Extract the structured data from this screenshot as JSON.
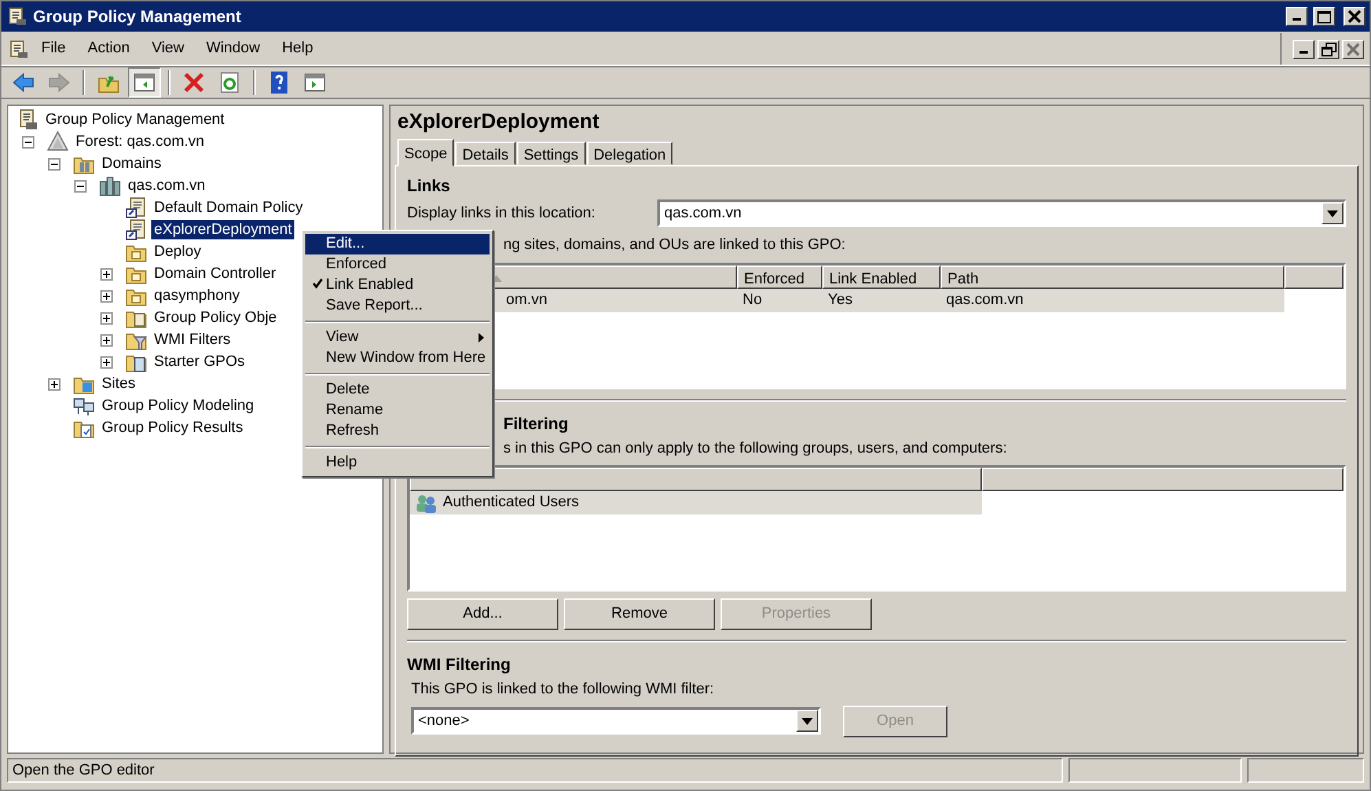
{
  "window": {
    "title": "Group Policy Management",
    "controls": [
      {
        "kind": "minimize",
        "disabled": false
      },
      {
        "kind": "maximize",
        "disabled": false
      },
      {
        "kind": "close",
        "disabled": false
      }
    ]
  },
  "menu_bar": [
    "File",
    "Action",
    "View",
    "Window",
    "Help"
  ],
  "inner_controls": [
    {
      "kind": "minimize",
      "disabled": false
    },
    {
      "kind": "restore",
      "disabled": false
    },
    {
      "kind": "close",
      "disabled": true
    }
  ],
  "toolbar": [
    {
      "kind": "back",
      "disabled": false,
      "pressed": false
    },
    {
      "kind": "forward",
      "disabled": true,
      "pressed": false
    },
    {
      "kind": "separator"
    },
    {
      "kind": "up",
      "disabled": false,
      "pressed": false
    },
    {
      "kind": "tree",
      "disabled": false,
      "pressed": true
    },
    {
      "kind": "separator"
    },
    {
      "kind": "delete",
      "disabled": false,
      "pressed": false
    },
    {
      "kind": "refresh",
      "disabled": false,
      "pressed": false
    },
    {
      "kind": "separator"
    },
    {
      "kind": "help",
      "disabled": false,
      "pressed": false
    },
    {
      "kind": "pane",
      "disabled": false,
      "pressed": false
    }
  ],
  "tree": [
    {
      "label": "Group Policy Management",
      "selected": false,
      "children": [
        {
          "label": "Forest: qas.com.vn",
          "expanded": true,
          "selected": false,
          "children": [
            {
              "label": "Domains",
              "expanded": true,
              "selected": false,
              "children": [
                {
                  "label": "qas.com.vn",
                  "expanded": true,
                  "selected": false,
                  "children": [
                    {
                      "label": "Default Domain Policy",
                      "selected": false
                    },
                    {
                      "label": "eXplorerDeployment",
                      "selected": true
                    },
                    {
                      "label": "Deploy",
                      "selected": false
                    },
                    {
                      "label": "Domain Controller",
                      "expanded": false,
                      "selected": false
                    },
                    {
                      "label": "qasymphony",
                      "expanded": false,
                      "selected": false
                    },
                    {
                      "label": "Group Policy Obje",
                      "expanded": false,
                      "selected": false
                    },
                    {
                      "label": "WMI Filters",
                      "expanded": false,
                      "selected": false
                    },
                    {
                      "label": "Starter GPOs",
                      "expanded": false,
                      "selected": false
                    }
                  ]
                }
              ]
            },
            {
              "label": "Sites",
              "expanded": false,
              "selected": false
            },
            {
              "label": "Group Policy Modeling",
              "selected": false
            },
            {
              "label": "Group Policy Results",
              "selected": false
            }
          ]
        }
      ]
    }
  ],
  "context_menu": [
    {
      "kind": "item",
      "label": "Edit...",
      "selected": true,
      "checked": false
    },
    {
      "kind": "item",
      "label": "Enforced",
      "selected": false,
      "checked": false
    },
    {
      "kind": "item",
      "label": "Link Enabled",
      "selected": false,
      "checked": true
    },
    {
      "kind": "item",
      "label": "Save Report...",
      "selected": false,
      "checked": false
    },
    {
      "kind": "separator"
    },
    {
      "kind": "submenu",
      "label": "View",
      "selected": false,
      "checked": false
    },
    {
      "kind": "item",
      "label": "New Window from Here",
      "selected": false,
      "checked": false
    },
    {
      "kind": "separator"
    },
    {
      "kind": "item",
      "label": "Delete",
      "selected": false,
      "checked": false
    },
    {
      "kind": "item",
      "label": "Rename",
      "selected": false,
      "checked": false
    },
    {
      "kind": "item",
      "label": "Refresh",
      "selected": false,
      "checked": false
    },
    {
      "kind": "separator"
    },
    {
      "kind": "item",
      "label": "Help",
      "selected": false,
      "checked": false
    }
  ],
  "detail": {
    "title": "eXplorerDeployment",
    "tabs": [
      {
        "label": "Scope",
        "selected": true
      },
      {
        "label": "Details",
        "selected": false
      },
      {
        "label": "Settings",
        "selected": false
      },
      {
        "label": "Delegation",
        "selected": false
      }
    ],
    "links": {
      "heading": "Links",
      "location_label": "Display links in this location:",
      "location_value": "qas.com.vn",
      "note": "ng sites, domains, and OUs are linked to this GPO:",
      "columns": [
        "",
        "Enforced",
        "Link Enabled",
        "Path"
      ],
      "rows": [
        [
          "om.vn",
          "No",
          "Yes",
          "qas.com.vn"
        ]
      ]
    },
    "security": {
      "heading": "Filtering",
      "note": "s in this GPO can only apply to the following groups, users, and computers:",
      "rows": [
        "Authenticated Users"
      ],
      "buttons": [
        {
          "label": "Add...",
          "disabled": false
        },
        {
          "label": "Remove",
          "disabled": false
        },
        {
          "label": "Properties",
          "disabled": true
        }
      ]
    },
    "wmi": {
      "heading": "WMI Filtering",
      "note": "This GPO is linked to the following WMI filter:",
      "value": "<none>",
      "button": {
        "label": "Open",
        "disabled": true
      }
    }
  },
  "status_bar": "Open the GPO editor"
}
